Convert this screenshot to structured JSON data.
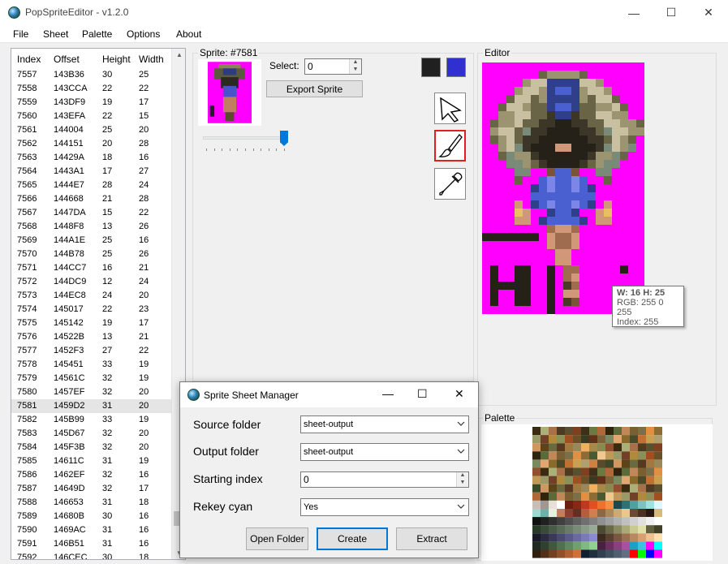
{
  "window": {
    "title": "PopSpriteEditor - v1.2.0",
    "min": "—",
    "max": "☐",
    "close": "✕"
  },
  "menu": [
    "File",
    "Sheet",
    "Palette",
    "Options",
    "About"
  ],
  "list": {
    "headers": [
      "Index",
      "Offset",
      "Height",
      "Width"
    ],
    "selected_index": "7581",
    "rows": [
      [
        "7557",
        "143B36",
        "30",
        "25"
      ],
      [
        "7558",
        "143CCA",
        "22",
        "22"
      ],
      [
        "7559",
        "143DF9",
        "19",
        "17"
      ],
      [
        "7560",
        "143EFA",
        "22",
        "15"
      ],
      [
        "7561",
        "144004",
        "25",
        "20"
      ],
      [
        "7562",
        "144151",
        "20",
        "28"
      ],
      [
        "7563",
        "14429A",
        "18",
        "16"
      ],
      [
        "7564",
        "1443A1",
        "17",
        "27"
      ],
      [
        "7565",
        "1444E7",
        "28",
        "24"
      ],
      [
        "7566",
        "144668",
        "21",
        "28"
      ],
      [
        "7567",
        "1447DA",
        "15",
        "22"
      ],
      [
        "7568",
        "1448F8",
        "13",
        "26"
      ],
      [
        "7569",
        "144A1E",
        "25",
        "16"
      ],
      [
        "7570",
        "144B78",
        "25",
        "26"
      ],
      [
        "7571",
        "144CC7",
        "16",
        "21"
      ],
      [
        "7572",
        "144DC9",
        "12",
        "24"
      ],
      [
        "7573",
        "144EC8",
        "24",
        "20"
      ],
      [
        "7574",
        "145017",
        "22",
        "23"
      ],
      [
        "7575",
        "145142",
        "19",
        "17"
      ],
      [
        "7576",
        "14522B",
        "13",
        "21"
      ],
      [
        "7577",
        "1452F3",
        "27",
        "22"
      ],
      [
        "7578",
        "145451",
        "33",
        "19"
      ],
      [
        "7579",
        "14561C",
        "32",
        "19"
      ],
      [
        "7580",
        "1457EF",
        "32",
        "20"
      ],
      [
        "7581",
        "1459D2",
        "31",
        "20"
      ],
      [
        "7582",
        "145B99",
        "33",
        "19"
      ],
      [
        "7583",
        "145D67",
        "32",
        "20"
      ],
      [
        "7584",
        "145F3B",
        "32",
        "20"
      ],
      [
        "7585",
        "14611C",
        "31",
        "19"
      ],
      [
        "7586",
        "1462EF",
        "32",
        "16"
      ],
      [
        "7587",
        "14649D",
        "32",
        "17"
      ],
      [
        "7588",
        "146653",
        "31",
        "18"
      ],
      [
        "7589",
        "14680B",
        "30",
        "16"
      ],
      [
        "7590",
        "1469AC",
        "31",
        "16"
      ],
      [
        "7591",
        "146B51",
        "31",
        "16"
      ],
      [
        "7592",
        "146CEC",
        "30",
        "18"
      ]
    ]
  },
  "sprite_panel": {
    "group_label": "Sprite: #7581",
    "select_label": "Select:",
    "select_value": "0",
    "export_label": "Export Sprite",
    "zoom_level": 0.95
  },
  "colors": {
    "primary": "#202020",
    "secondary": "#3030d0",
    "transparent": "#ff00ff",
    "accent": "#0078d7"
  },
  "tools": [
    "pointer-icon",
    "brush-icon",
    "eyedropper-icon"
  ],
  "editor": {
    "group_label": "Editor",
    "tooltip": {
      "size": "W: 16 H: 25",
      "rgb": "RGB: 255 0 255",
      "index": "Index: 255"
    }
  },
  "palette": {
    "group_label": "Palette"
  },
  "dialog": {
    "title": "Sprite Sheet Manager",
    "fields": [
      {
        "label": "Source folder",
        "value": "sheet-output"
      },
      {
        "label": "Output folder",
        "value": "sheet-output"
      },
      {
        "label": "Starting index",
        "value": "0"
      },
      {
        "label": "Rekey cyan",
        "value": "Yes"
      }
    ],
    "buttons": [
      "Open Folder",
      "Create",
      "Extract"
    ]
  }
}
